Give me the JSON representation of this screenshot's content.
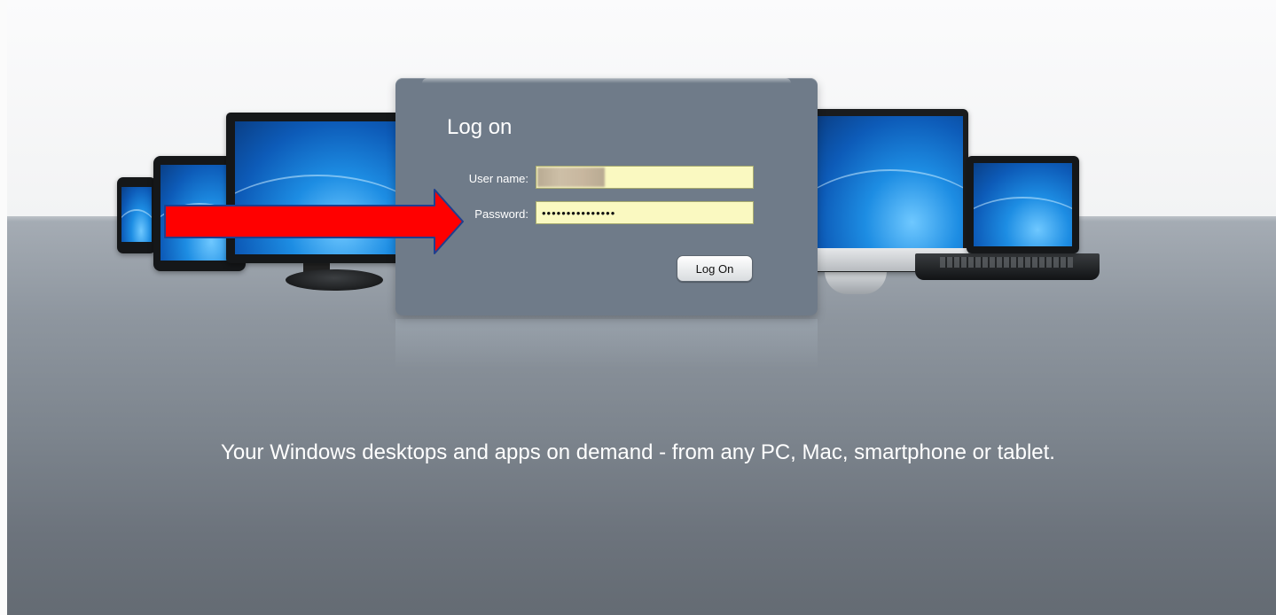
{
  "login": {
    "title": "Log on",
    "username_label": "User name:",
    "username_value": "",
    "password_label": "Password:",
    "password_value": "•••••••••••••••",
    "submit_label": "Log On"
  },
  "tagline": "Your Windows desktops and apps on demand - from any PC, Mac, smartphone or tablet.",
  "annotation": {
    "arrow_color": "#ff0000",
    "arrow_outline": "#1f3f8f",
    "arrow_target": "password-field"
  },
  "colors": {
    "panel": "#6f7b89",
    "field_bg": "#faf9c1",
    "floor": "#8e969f"
  }
}
